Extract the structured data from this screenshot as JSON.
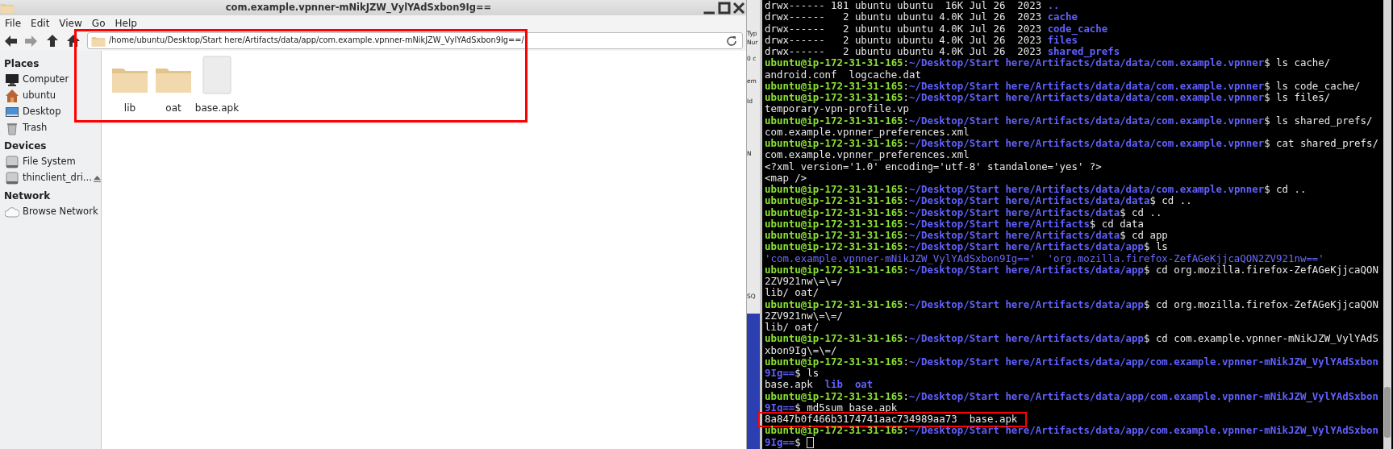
{
  "file_manager": {
    "title": "com.example.vpnner-mNikJZW_VylYAdSxbon9Ig==",
    "highlighted": true,
    "menu": [
      "File",
      "Edit",
      "View",
      "Go",
      "Help"
    ],
    "nav_buttons": [
      {
        "kind": "back",
        "disabled": false
      },
      {
        "kind": "forward",
        "disabled": true
      },
      {
        "kind": "up",
        "disabled": false
      },
      {
        "kind": "home",
        "disabled": false
      }
    ],
    "address": "/home/ubuntu/Desktop/Start here/Artifacts/data/app/com.example.vpnner-mNikJZW_VylYAdSxbon9Ig==/",
    "sidebar": [
      {
        "heading": "Places",
        "items": [
          {
            "label": "Computer",
            "kind": "computer",
            "ejectable": false
          },
          {
            "label": "ubuntu",
            "kind": "home",
            "ejectable": false
          },
          {
            "label": "Desktop",
            "kind": "desktop",
            "ejectable": false
          },
          {
            "label": "Trash",
            "kind": "trash",
            "ejectable": false
          }
        ]
      },
      {
        "heading": "Devices",
        "items": [
          {
            "label": "File System",
            "kind": "drive",
            "ejectable": false
          },
          {
            "label": "thinclient_dri...",
            "kind": "drive",
            "ejectable": true
          }
        ]
      },
      {
        "heading": "Network",
        "items": [
          {
            "label": "Browse Network",
            "kind": "network",
            "ejectable": false
          }
        ]
      }
    ],
    "files": [
      {
        "name": "lib",
        "kind": "folder"
      },
      {
        "name": "oat",
        "kind": "folder"
      },
      {
        "name": "base.apk",
        "kind": "file"
      }
    ]
  },
  "background_window": {
    "fragments": [
      "Typ",
      "Nur",
      "0 c",
      "em",
      "Id",
      "N",
      "SQ"
    ]
  },
  "terminal": {
    "lines": [
      {
        "parts": [
          {
            "kind": "plain",
            "text": "drwx------ 181 ubuntu ubuntu  16K Jul 26  2023 "
          },
          {
            "kind": "dir",
            "text": ".."
          }
        ]
      },
      {
        "parts": [
          {
            "kind": "plain",
            "text": "drwx------   2 ubuntu ubuntu 4.0K Jul 26  2023 "
          },
          {
            "kind": "dir",
            "text": "cache"
          }
        ]
      },
      {
        "parts": [
          {
            "kind": "plain",
            "text": "drwx------   2 ubuntu ubuntu 4.0K Jul 26  2023 "
          },
          {
            "kind": "dir",
            "text": "code_cache"
          }
        ]
      },
      {
        "parts": [
          {
            "kind": "plain",
            "text": "drwx------   2 ubuntu ubuntu 4.0K Jul 26  2023 "
          },
          {
            "kind": "dir",
            "text": "files"
          }
        ]
      },
      {
        "parts": [
          {
            "kind": "plain",
            "text": "drwx------   2 ubuntu ubuntu 4.0K Jul 26  2023 "
          },
          {
            "kind": "dir",
            "text": "shared_prefs"
          }
        ]
      },
      {
        "parts": [
          {
            "kind": "user",
            "text": "ubuntu@ip-172-31-31-165"
          },
          {
            "kind": "plain",
            "text": ":"
          },
          {
            "kind": "path",
            "text": "~/Desktop/Start here/Artifacts/data/data/com.example.vpnner"
          },
          {
            "kind": "plain",
            "text": "$ ls cache/"
          }
        ]
      },
      {
        "parts": [
          {
            "kind": "plain",
            "text": "android.conf  logcache.dat"
          }
        ]
      },
      {
        "parts": [
          {
            "kind": "user",
            "text": "ubuntu@ip-172-31-31-165"
          },
          {
            "kind": "plain",
            "text": ":"
          },
          {
            "kind": "path",
            "text": "~/Desktop/Start here/Artifacts/data/data/com.example.vpnner"
          },
          {
            "kind": "plain",
            "text": "$ ls code_cache/"
          }
        ]
      },
      {
        "parts": [
          {
            "kind": "user",
            "text": "ubuntu@ip-172-31-31-165"
          },
          {
            "kind": "plain",
            "text": ":"
          },
          {
            "kind": "path",
            "text": "~/Desktop/Start here/Artifacts/data/data/com.example.vpnner"
          },
          {
            "kind": "plain",
            "text": "$ ls files/"
          }
        ]
      },
      {
        "parts": [
          {
            "kind": "plain",
            "text": "temporary-vpn-profile.vp"
          }
        ]
      },
      {
        "parts": [
          {
            "kind": "user",
            "text": "ubuntu@ip-172-31-31-165"
          },
          {
            "kind": "plain",
            "text": ":"
          },
          {
            "kind": "path",
            "text": "~/Desktop/Start here/Artifacts/data/data/com.example.vpnner"
          },
          {
            "kind": "plain",
            "text": "$ ls shared_prefs/"
          }
        ]
      },
      {
        "parts": [
          {
            "kind": "plain",
            "text": "com.example.vpnner_preferences.xml"
          }
        ]
      },
      {
        "parts": [
          {
            "kind": "user",
            "text": "ubuntu@ip-172-31-31-165"
          },
          {
            "kind": "plain",
            "text": ":"
          },
          {
            "kind": "path",
            "text": "~/Desktop/Start here/Artifacts/data/data/com.example.vpnner"
          },
          {
            "kind": "plain",
            "text": "$ cat shared_prefs/"
          }
        ]
      },
      {
        "parts": [
          {
            "kind": "plain",
            "text": "com.example.vpnner_preferences.xml"
          }
        ]
      },
      {
        "parts": [
          {
            "kind": "plain",
            "text": "<?xml version='1.0' encoding='utf-8' standalone='yes' ?>"
          }
        ]
      },
      {
        "parts": [
          {
            "kind": "plain",
            "text": "<map />"
          }
        ]
      },
      {
        "parts": [
          {
            "kind": "user",
            "text": "ubuntu@ip-172-31-31-165"
          },
          {
            "kind": "plain",
            "text": ":"
          },
          {
            "kind": "path",
            "text": "~/Desktop/Start here/Artifacts/data/data/com.example.vpnner"
          },
          {
            "kind": "plain",
            "text": "$ cd .."
          }
        ]
      },
      {
        "parts": [
          {
            "kind": "user",
            "text": "ubuntu@ip-172-31-31-165"
          },
          {
            "kind": "plain",
            "text": ":"
          },
          {
            "kind": "path",
            "text": "~/Desktop/Start here/Artifacts/data/data"
          },
          {
            "kind": "plain",
            "text": "$ cd .."
          }
        ]
      },
      {
        "parts": [
          {
            "kind": "user",
            "text": "ubuntu@ip-172-31-31-165"
          },
          {
            "kind": "plain",
            "text": ":"
          },
          {
            "kind": "path",
            "text": "~/Desktop/Start here/Artifacts/data"
          },
          {
            "kind": "plain",
            "text": "$ cd .."
          }
        ]
      },
      {
        "parts": [
          {
            "kind": "user",
            "text": "ubuntu@ip-172-31-31-165"
          },
          {
            "kind": "plain",
            "text": ":"
          },
          {
            "kind": "path",
            "text": "~/Desktop/Start here/Artifacts"
          },
          {
            "kind": "plain",
            "text": "$ cd data"
          }
        ]
      },
      {
        "parts": [
          {
            "kind": "user",
            "text": "ubuntu@ip-172-31-31-165"
          },
          {
            "kind": "plain",
            "text": ":"
          },
          {
            "kind": "path",
            "text": "~/Desktop/Start here/Artifacts/data"
          },
          {
            "kind": "plain",
            "text": "$ cd app"
          }
        ]
      },
      {
        "parts": [
          {
            "kind": "user",
            "text": "ubuntu@ip-172-31-31-165"
          },
          {
            "kind": "plain",
            "text": ":"
          },
          {
            "kind": "path",
            "text": "~/Desktop/Start here/Artifacts/data/app"
          },
          {
            "kind": "plain",
            "text": "$ ls"
          }
        ]
      },
      {
        "parts": [
          {
            "kind": "quoted",
            "text": "'com.example.vpnner-mNikJZW_VylYAdSxbon9Ig=='  'org.mozilla.firefox-ZefAGeKjjcaQON2ZV921nw=='"
          }
        ]
      },
      {
        "parts": [
          {
            "kind": "user",
            "text": "ubuntu@ip-172-31-31-165"
          },
          {
            "kind": "plain",
            "text": ":"
          },
          {
            "kind": "path",
            "text": "~/Desktop/Start here/Artifacts/data/app"
          },
          {
            "kind": "plain",
            "text": "$ cd org.mozilla.firefox-ZefAGeKjjcaQON"
          }
        ]
      },
      {
        "parts": [
          {
            "kind": "plain",
            "text": "2ZV921nw\\=\\=/"
          }
        ]
      },
      {
        "parts": [
          {
            "kind": "plain",
            "text": "lib/ oat/"
          }
        ]
      },
      {
        "parts": [
          {
            "kind": "user",
            "text": "ubuntu@ip-172-31-31-165"
          },
          {
            "kind": "plain",
            "text": ":"
          },
          {
            "kind": "path",
            "text": "~/Desktop/Start here/Artifacts/data/app"
          },
          {
            "kind": "plain",
            "text": "$ cd org.mozilla.firefox-ZefAGeKjjcaQON"
          }
        ]
      },
      {
        "parts": [
          {
            "kind": "plain",
            "text": "2ZV921nw\\=\\=/"
          }
        ]
      },
      {
        "parts": [
          {
            "kind": "plain",
            "text": "lib/ oat/"
          }
        ]
      },
      {
        "parts": [
          {
            "kind": "user",
            "text": "ubuntu@ip-172-31-31-165"
          },
          {
            "kind": "plain",
            "text": ":"
          },
          {
            "kind": "path",
            "text": "~/Desktop/Start here/Artifacts/data/app"
          },
          {
            "kind": "plain",
            "text": "$ cd com.example.vpnner-mNikJZW_VylYAdS"
          }
        ]
      },
      {
        "parts": [
          {
            "kind": "plain",
            "text": "xbon9Ig\\=\\=/"
          }
        ]
      },
      {
        "parts": [
          {
            "kind": "user",
            "text": "ubuntu@ip-172-31-31-165"
          },
          {
            "kind": "plain",
            "text": ":"
          },
          {
            "kind": "path",
            "text": "~/Desktop/Start here/Artifacts/data/app/com.example.vpnner-mNikJZW_VylYAdSxbon"
          }
        ]
      },
      {
        "parts": [
          {
            "kind": "path",
            "text": "9Ig=="
          },
          {
            "kind": "plain",
            "text": "$ ls"
          }
        ]
      },
      {
        "parts": [
          {
            "kind": "plain",
            "text": "base.apk  "
          },
          {
            "kind": "dir",
            "text": "lib  oat"
          }
        ]
      },
      {
        "parts": [
          {
            "kind": "user",
            "text": "ubuntu@ip-172-31-31-165"
          },
          {
            "kind": "plain",
            "text": ":"
          },
          {
            "kind": "path",
            "text": "~/Desktop/Start here/Artifacts/data/app/com.example.vpnner-mNikJZW_VylYAdSxbon"
          }
        ]
      },
      {
        "parts": [
          {
            "kind": "path",
            "text": "9Ig=="
          },
          {
            "kind": "plain",
            "text": "$ md5sum base.apk"
          }
        ]
      },
      {
        "highlighted": true,
        "parts": [
          {
            "kind": "plain",
            "text": "8a847b0f466b3174741aac734989aa73  base.apk"
          }
        ]
      },
      {
        "parts": [
          {
            "kind": "user",
            "text": "ubuntu@ip-172-31-31-165"
          },
          {
            "kind": "plain",
            "text": ":"
          },
          {
            "kind": "path",
            "text": "~/Desktop/Start here/Artifacts/data/app/com.example.vpnner-mNikJZW_VylYAdSxbon"
          }
        ]
      },
      {
        "cursor": true,
        "parts": [
          {
            "kind": "path",
            "text": "9Ig=="
          },
          {
            "kind": "plain",
            "text": "$ "
          }
        ]
      }
    ]
  }
}
